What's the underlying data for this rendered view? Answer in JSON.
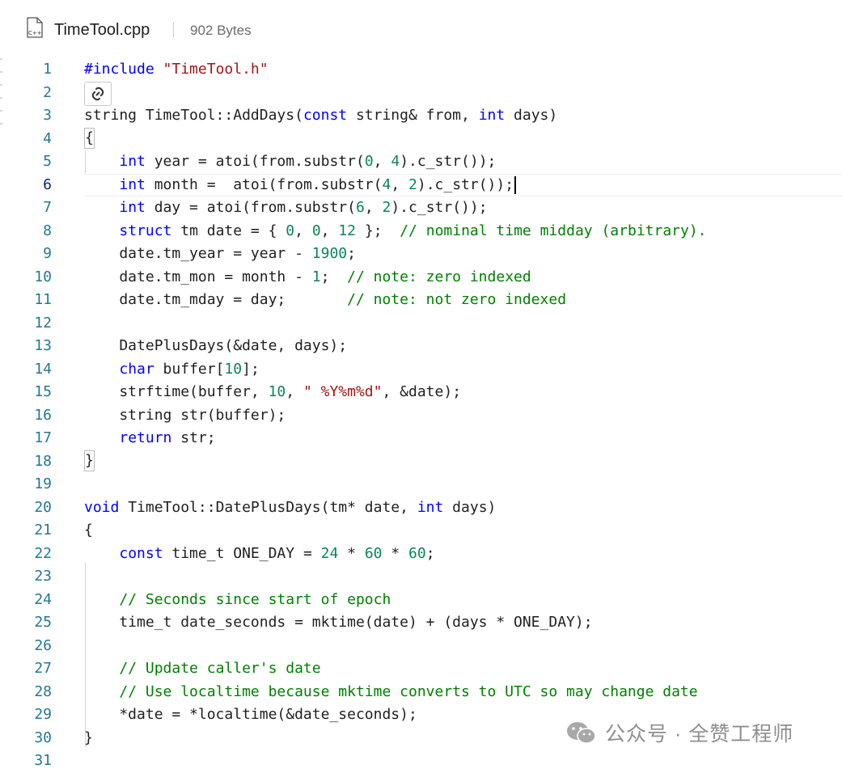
{
  "file": {
    "icon": "cpp-file-icon",
    "icon_text": "C++",
    "name": "TimeTool.cpp",
    "size": "902 Bytes"
  },
  "editor": {
    "active_line": 6,
    "lines": [
      {
        "n": "1",
        "t": [
          [
            "pp",
            "#include"
          ],
          [
            "",
            " "
          ],
          [
            "str",
            "\"TimeTool.h\""
          ]
        ]
      },
      {
        "n": "2",
        "t": []
      },
      {
        "n": "3",
        "t": [
          [
            "",
            "string TimeTool::AddDays("
          ],
          [
            "kw",
            "const"
          ],
          [
            "",
            " string& from, "
          ],
          [
            "kw",
            "int"
          ],
          [
            "",
            " days)"
          ]
        ]
      },
      {
        "n": "4",
        "t": [
          [
            "",
            "{"
          ]
        ]
      },
      {
        "n": "5",
        "t": [
          [
            "",
            "    "
          ],
          [
            "kw",
            "int"
          ],
          [
            "",
            " year = atoi(from.substr("
          ],
          [
            "num",
            "0"
          ],
          [
            "",
            ", "
          ],
          [
            "num",
            "4"
          ],
          [
            "",
            ").c_str());"
          ]
        ]
      },
      {
        "n": "6",
        "t": [
          [
            "",
            "    "
          ],
          [
            "kw",
            "int"
          ],
          [
            "",
            " month =  atoi(from.substr("
          ],
          [
            "num",
            "4"
          ],
          [
            "",
            ", "
          ],
          [
            "num",
            "2"
          ],
          [
            "",
            ").c_str());"
          ]
        ]
      },
      {
        "n": "7",
        "t": [
          [
            "",
            "    "
          ],
          [
            "kw",
            "int"
          ],
          [
            "",
            " day = atoi(from.substr("
          ],
          [
            "num",
            "6"
          ],
          [
            "",
            ", "
          ],
          [
            "num",
            "2"
          ],
          [
            "",
            ").c_str());"
          ]
        ]
      },
      {
        "n": "8",
        "t": [
          [
            "",
            "    "
          ],
          [
            "kw",
            "struct"
          ],
          [
            "",
            " tm date = { "
          ],
          [
            "num",
            "0"
          ],
          [
            "",
            ", "
          ],
          [
            "num",
            "0"
          ],
          [
            "",
            ", "
          ],
          [
            "num",
            "12"
          ],
          [
            "",
            " };  "
          ],
          [
            "cm",
            "// nominal time midday (arbitrary)."
          ]
        ]
      },
      {
        "n": "9",
        "t": [
          [
            "",
            "    date.tm_year = year - "
          ],
          [
            "num",
            "1900"
          ],
          [
            "",
            ";"
          ]
        ]
      },
      {
        "n": "10",
        "t": [
          [
            "",
            "    date.tm_mon = month - "
          ],
          [
            "num",
            "1"
          ],
          [
            "",
            ";  "
          ],
          [
            "cm",
            "// note: zero indexed"
          ]
        ]
      },
      {
        "n": "11",
        "t": [
          [
            "",
            "    date.tm_mday = day;       "
          ],
          [
            "cm",
            "// note: not zero indexed"
          ]
        ]
      },
      {
        "n": "12",
        "t": []
      },
      {
        "n": "13",
        "t": [
          [
            "",
            "    DatePlusDays(&date, days);"
          ]
        ]
      },
      {
        "n": "14",
        "t": [
          [
            "",
            "    "
          ],
          [
            "kw",
            "char"
          ],
          [
            "",
            " buffer["
          ],
          [
            "num",
            "10"
          ],
          [
            "",
            "];"
          ]
        ]
      },
      {
        "n": "15",
        "t": [
          [
            "",
            "    strftime(buffer, "
          ],
          [
            "num",
            "10"
          ],
          [
            "",
            ", "
          ],
          [
            "str",
            "\" %Y%m%d\""
          ],
          [
            "",
            ", &date);"
          ]
        ]
      },
      {
        "n": "16",
        "t": [
          [
            "",
            "    string str(buffer);"
          ]
        ]
      },
      {
        "n": "17",
        "t": [
          [
            "",
            "    "
          ],
          [
            "kw",
            "return"
          ],
          [
            "",
            " str;"
          ]
        ]
      },
      {
        "n": "18",
        "t": [
          [
            "",
            "}"
          ]
        ]
      },
      {
        "n": "19",
        "t": []
      },
      {
        "n": "20",
        "t": [
          [
            "kw",
            "void"
          ],
          [
            "",
            " TimeTool::DatePlusDays(tm* date, "
          ],
          [
            "kw",
            "int"
          ],
          [
            "",
            " days)"
          ]
        ]
      },
      {
        "n": "21",
        "t": [
          [
            "",
            "{"
          ]
        ]
      },
      {
        "n": "22",
        "t": [
          [
            "",
            "    "
          ],
          [
            "kw",
            "const"
          ],
          [
            "",
            " time_t ONE_DAY = "
          ],
          [
            "num",
            "24"
          ],
          [
            "",
            " * "
          ],
          [
            "num",
            "60"
          ],
          [
            "",
            " * "
          ],
          [
            "num",
            "60"
          ],
          [
            "",
            ";"
          ]
        ]
      },
      {
        "n": "23",
        "t": []
      },
      {
        "n": "24",
        "t": [
          [
            "",
            "    "
          ],
          [
            "cm",
            "// Seconds since start of epoch"
          ]
        ]
      },
      {
        "n": "25",
        "t": [
          [
            "",
            "    time_t date_seconds = mktime(date) + (days * ONE_DAY);"
          ]
        ]
      },
      {
        "n": "26",
        "t": []
      },
      {
        "n": "27",
        "t": [
          [
            "",
            "    "
          ],
          [
            "cm",
            "// Update caller's date"
          ]
        ]
      },
      {
        "n": "28",
        "t": [
          [
            "",
            "    "
          ],
          [
            "cm",
            "// Use localtime because mktime converts to UTC so may change date"
          ]
        ]
      },
      {
        "n": "29",
        "t": [
          [
            "",
            "    *date = *localtime(&date_seconds);"
          ]
        ]
      },
      {
        "n": "30",
        "t": [
          [
            "",
            "}"
          ]
        ]
      },
      {
        "n": "31",
        "t": []
      }
    ]
  },
  "copilot_button": {
    "icon": "copilot-link-icon"
  },
  "watermark": {
    "icon": "wechat-icon",
    "text": "公众号 · 全赞工程师"
  },
  "colors": {
    "keyword": "#0000ff",
    "string": "#a31515",
    "number": "#098658",
    "comment": "#008000",
    "line_number": "#237893",
    "text": "#1f1f1f"
  }
}
